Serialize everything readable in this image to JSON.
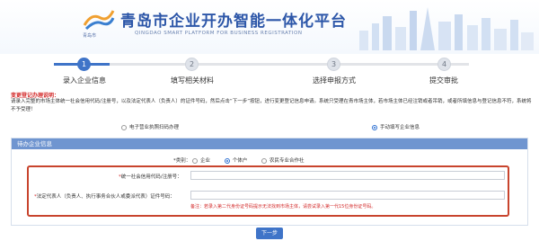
{
  "header": {
    "title": "青岛市企业开办智能一体化平台",
    "subtitle": "QINGDAO SMART PLATFORM FOR BUSINESS REGISTRATION",
    "logo_caption": "青岛市"
  },
  "steps": [
    {
      "number": "1",
      "label": "录入企业信息",
      "state": "active"
    },
    {
      "number": "2",
      "label": "填写相关材料",
      "state": "inactive"
    },
    {
      "number": "3",
      "label": "选择申报方式",
      "state": "inactive"
    },
    {
      "number": "4",
      "label": "提交审批",
      "state": "inactive"
    }
  ],
  "notice": {
    "title": "变更登记办理说明：",
    "text": "请录入完整的市场主体统一社会信用代码/注册号，以及法定代表人（负责人）的证件号码，然后点击“下一步”按钮，进行变更登记信息申请。系统只受理在青市场主体，若市场主体已经注销或者吊销，或者所填信息与登记信息不符，系统将不予受理！"
  },
  "mode_options": {
    "option_a": "电子营业执照扫码办理",
    "option_b": "手动填写企业信息"
  },
  "panel": {
    "title": "待办企业信息",
    "type_label": "*类别：",
    "type_options": [
      "企业",
      "个体户",
      "农民专业合作社"
    ]
  },
  "form": {
    "credit_code_label": "统一社会信用代码/注册号：",
    "credit_code_value": "",
    "id_label": "法定代表人（负责人、执行事务合伙人或委派代表）证件号码：",
    "id_value": "",
    "hint": "备注：若录入第二代身份证号码提示无法找到市场主体，请尝试录入第一代15位身份证号码。"
  },
  "buttons": {
    "next": "下一步"
  },
  "colors": {
    "brand_blue": "#2c56a8",
    "active_step": "#3f74c8",
    "panel_header": "#6f95d0",
    "highlight_red": "#c8442d",
    "notice_red": "#d32a2a"
  }
}
